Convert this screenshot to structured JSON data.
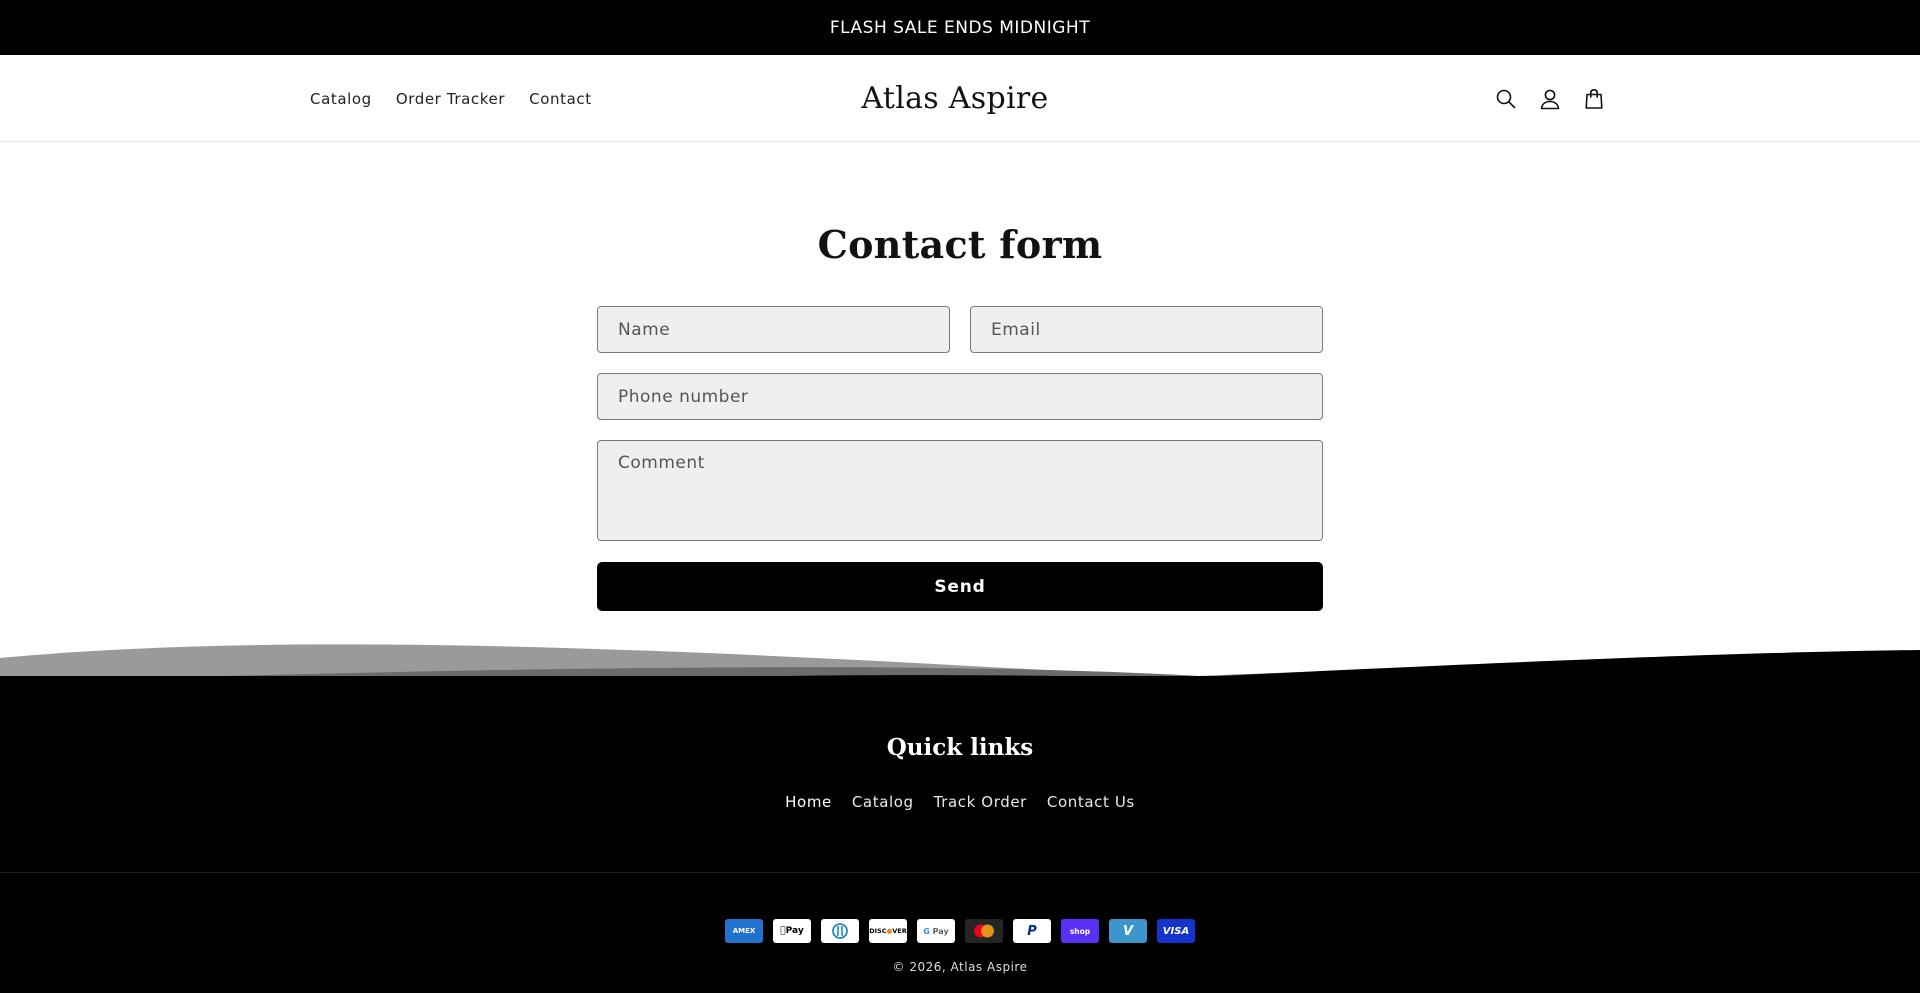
{
  "announcement": {
    "text": "FLASH SALE ENDS MIDNIGHT"
  },
  "header": {
    "nav": [
      {
        "label": "Catalog"
      },
      {
        "label": "Order Tracker"
      },
      {
        "label": "Contact"
      }
    ],
    "logo": "Atlas Aspire",
    "icons": [
      "search-icon",
      "account-icon",
      "cart-icon"
    ]
  },
  "main": {
    "title": "Contact form",
    "form": {
      "name_placeholder": "Name",
      "email_placeholder": "Email",
      "phone_placeholder": "Phone number",
      "comment_placeholder": "Comment",
      "send_label": "Send"
    }
  },
  "footer": {
    "quick_links_title": "Quick links",
    "links": [
      {
        "label": "Home"
      },
      {
        "label": "Catalog"
      },
      {
        "label": "Track Order"
      },
      {
        "label": "Contact Us"
      }
    ],
    "payments": [
      "American Express",
      "Apple Pay",
      "Diners Club",
      "Discover",
      "Google Pay",
      "Mastercard",
      "PayPal",
      "Shop Pay",
      "Venmo",
      "Visa"
    ],
    "copyright": "© 2026, Atlas Aspire"
  },
  "colors": {
    "background": "#ffffff",
    "foreground": "#121212",
    "footer_bg": "#000000",
    "field_bg": "#efefef",
    "button_bg": "#000000"
  }
}
